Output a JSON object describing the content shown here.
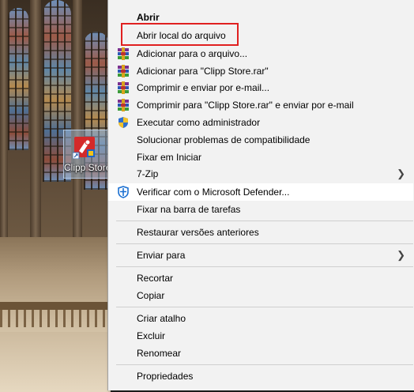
{
  "desktop": {
    "icon_label": "Clipp Store"
  },
  "menu": {
    "items": [
      {
        "label": "Abrir",
        "icon": "none",
        "bold": true
      },
      {
        "label": "Abrir local do arquivo",
        "icon": "none",
        "highlighted": true
      },
      {
        "label": "Adicionar para o arquivo...",
        "icon": "winrar-icon"
      },
      {
        "label": "Adicionar para \"Clipp Store.rar\"",
        "icon": "winrar-icon"
      },
      {
        "label": "Comprimir e enviar por e-mail...",
        "icon": "winrar-icon"
      },
      {
        "label": "Comprimir para \"Clipp Store.rar\" e enviar por e-mail",
        "icon": "winrar-icon"
      },
      {
        "label": "Executar como administrador",
        "icon": "uac-shield-icon"
      },
      {
        "label": "Solucionar problemas de compatibilidade",
        "icon": "none"
      },
      {
        "label": "Fixar em Iniciar",
        "icon": "none"
      },
      {
        "label": "7-Zip",
        "icon": "none",
        "submenu": true
      },
      {
        "label": "Verificar com o Microsoft Defender...",
        "icon": "defender-icon",
        "hover": true
      },
      {
        "label": "Fixar na barra de tarefas",
        "icon": "none"
      },
      {
        "label": "Restaurar versões anteriores",
        "icon": "none"
      },
      {
        "label": "Enviar para",
        "icon": "none",
        "submenu": true
      },
      {
        "label": "Recortar",
        "icon": "none"
      },
      {
        "label": "Copiar",
        "icon": "none"
      },
      {
        "label": "Criar atalho",
        "icon": "none"
      },
      {
        "label": "Excluir",
        "icon": "none"
      },
      {
        "label": "Renomear",
        "icon": "none"
      },
      {
        "label": "Propriedades",
        "icon": "none"
      }
    ]
  },
  "colors": {
    "menu_bg": "#f2f2f2",
    "highlight_box": "#e02020",
    "defender_blue": "#1a6fd1"
  }
}
